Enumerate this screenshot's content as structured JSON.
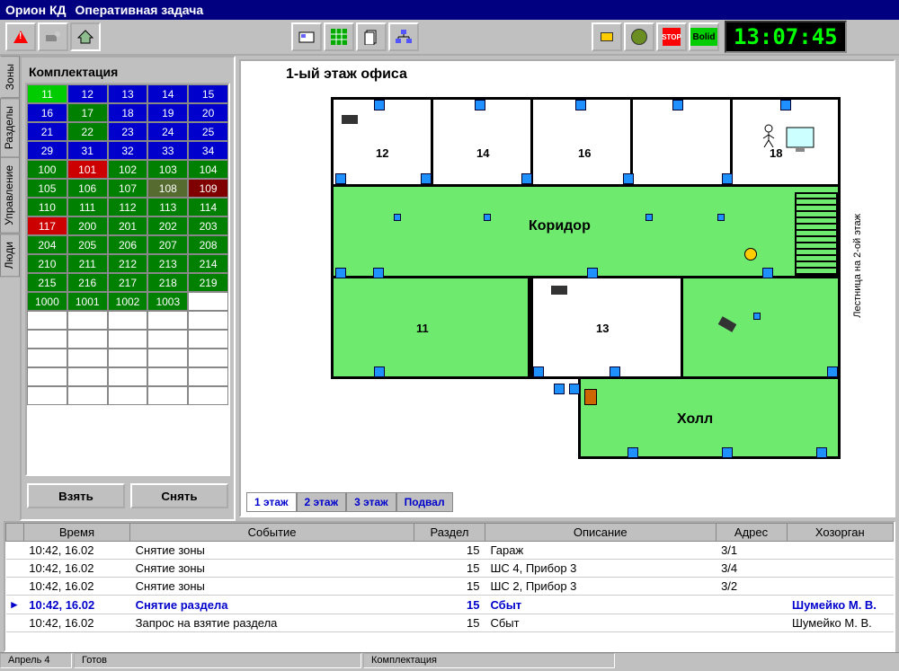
{
  "title": {
    "app": "Орион КД",
    "task": "Оперативная задача"
  },
  "clock": "13:07:45",
  "toolbar": {
    "stop": "STOP",
    "bolid": "Bolid"
  },
  "sidetabs": [
    "Зоны",
    "Разделы",
    "Управление",
    "Люди"
  ],
  "panel": {
    "title": "Комплектация",
    "btn_take": "Взять",
    "btn_remove": "Снять"
  },
  "zones": [
    {
      "n": "11",
      "c": "lime"
    },
    {
      "n": "12",
      "c": "blue"
    },
    {
      "n": "13",
      "c": "blue"
    },
    {
      "n": "14",
      "c": "blue"
    },
    {
      "n": "15",
      "c": "blue"
    },
    {
      "n": "16",
      "c": "blue"
    },
    {
      "n": "17",
      "c": "green"
    },
    {
      "n": "18",
      "c": "blue"
    },
    {
      "n": "19",
      "c": "blue"
    },
    {
      "n": "20",
      "c": "blue"
    },
    {
      "n": "21",
      "c": "blue"
    },
    {
      "n": "22",
      "c": "green"
    },
    {
      "n": "23",
      "c": "blue"
    },
    {
      "n": "24",
      "c": "blue"
    },
    {
      "n": "25",
      "c": "blue"
    },
    {
      "n": "29",
      "c": "blue"
    },
    {
      "n": "31",
      "c": "blue"
    },
    {
      "n": "32",
      "c": "blue"
    },
    {
      "n": "33",
      "c": "blue"
    },
    {
      "n": "34",
      "c": "blue"
    },
    {
      "n": "100",
      "c": "green"
    },
    {
      "n": "101",
      "c": "red"
    },
    {
      "n": "102",
      "c": "green"
    },
    {
      "n": "103",
      "c": "green"
    },
    {
      "n": "104",
      "c": "green"
    },
    {
      "n": "105",
      "c": "green"
    },
    {
      "n": "106",
      "c": "green"
    },
    {
      "n": "107",
      "c": "green"
    },
    {
      "n": "108",
      "c": "olive"
    },
    {
      "n": "109",
      "c": "darkred"
    },
    {
      "n": "110",
      "c": "green"
    },
    {
      "n": "111",
      "c": "green"
    },
    {
      "n": "112",
      "c": "green"
    },
    {
      "n": "113",
      "c": "green"
    },
    {
      "n": "114",
      "c": "green"
    },
    {
      "n": "117",
      "c": "red"
    },
    {
      "n": "200",
      "c": "green"
    },
    {
      "n": "201",
      "c": "green"
    },
    {
      "n": "202",
      "c": "green"
    },
    {
      "n": "203",
      "c": "green"
    },
    {
      "n": "204",
      "c": "green"
    },
    {
      "n": "205",
      "c": "green"
    },
    {
      "n": "206",
      "c": "green"
    },
    {
      "n": "207",
      "c": "green"
    },
    {
      "n": "208",
      "c": "green"
    },
    {
      "n": "210",
      "c": "green"
    },
    {
      "n": "211",
      "c": "green"
    },
    {
      "n": "212",
      "c": "green"
    },
    {
      "n": "213",
      "c": "green"
    },
    {
      "n": "214",
      "c": "green"
    },
    {
      "n": "215",
      "c": "green"
    },
    {
      "n": "216",
      "c": "green"
    },
    {
      "n": "217",
      "c": "green"
    },
    {
      "n": "218",
      "c": "green"
    },
    {
      "n": "219",
      "c": "green"
    },
    {
      "n": "1000",
      "c": "green"
    },
    {
      "n": "1001",
      "c": "green"
    },
    {
      "n": "1002",
      "c": "green"
    },
    {
      "n": "1003",
      "c": "green"
    },
    {
      "n": "",
      "c": "empty"
    },
    {
      "n": "",
      "c": "empty"
    },
    {
      "n": "",
      "c": "empty"
    },
    {
      "n": "",
      "c": "empty"
    },
    {
      "n": "",
      "c": "empty"
    },
    {
      "n": "",
      "c": "empty"
    },
    {
      "n": "",
      "c": "empty"
    },
    {
      "n": "",
      "c": "empty"
    },
    {
      "n": "",
      "c": "empty"
    },
    {
      "n": "",
      "c": "empty"
    },
    {
      "n": "",
      "c": "empty"
    },
    {
      "n": "",
      "c": "empty"
    },
    {
      "n": "",
      "c": "empty"
    },
    {
      "n": "",
      "c": "empty"
    },
    {
      "n": "",
      "c": "empty"
    },
    {
      "n": "",
      "c": "empty"
    },
    {
      "n": "",
      "c": "empty"
    },
    {
      "n": "",
      "c": "empty"
    },
    {
      "n": "",
      "c": "empty"
    },
    {
      "n": "",
      "c": "empty"
    },
    {
      "n": "",
      "c": "empty"
    },
    {
      "n": "",
      "c": "empty"
    },
    {
      "n": "",
      "c": "empty"
    },
    {
      "n": "",
      "c": "empty"
    },
    {
      "n": "",
      "c": "empty"
    },
    {
      "n": "",
      "c": "empty"
    }
  ],
  "plan": {
    "title": "1-ый этаж офиса",
    "corridor": "Коридор",
    "hall": "Холл",
    "stair": "Лестница на 2-ой этаж",
    "rooms": {
      "r11": "11",
      "r12": "12",
      "r13": "13",
      "r14": "14",
      "r16": "16",
      "r18": "18"
    }
  },
  "floor_tabs": [
    "1 этаж",
    "2 этаж",
    "3 этаж",
    "Подвал"
  ],
  "log": {
    "headers": [
      "",
      "Время",
      "Событие",
      "Раздел",
      "Описание",
      "Адрес",
      "Хозорган"
    ],
    "rows": [
      {
        "mark": "",
        "time": "10:42, 16.02",
        "event": "Снятие зоны",
        "sect": "15",
        "desc": "Гараж",
        "addr": "3/1",
        "org": ""
      },
      {
        "mark": "",
        "time": "10:42, 16.02",
        "event": "Снятие зоны",
        "sect": "15",
        "desc": "ШС 4, Прибор 3",
        "addr": "3/4",
        "org": ""
      },
      {
        "mark": "",
        "time": "10:42, 16.02",
        "event": "Снятие зоны",
        "sect": "15",
        "desc": "ШС 2, Прибор 3",
        "addr": "3/2",
        "org": ""
      },
      {
        "mark": "▸",
        "time": "10:42, 16.02",
        "event": "Снятие раздела",
        "sect": "15",
        "desc": "Сбыт",
        "addr": "",
        "org": "Шумейко М. В.",
        "sel": true
      },
      {
        "mark": "",
        "time": "10:42, 16.02",
        "event": "Запрос на взятие раздела",
        "sect": "15",
        "desc": "Сбыт",
        "addr": "",
        "org": "Шумейко М. В."
      }
    ]
  },
  "status": {
    "date": "Апрель 4",
    "state": "Готов",
    "panel": "Комплектация"
  }
}
